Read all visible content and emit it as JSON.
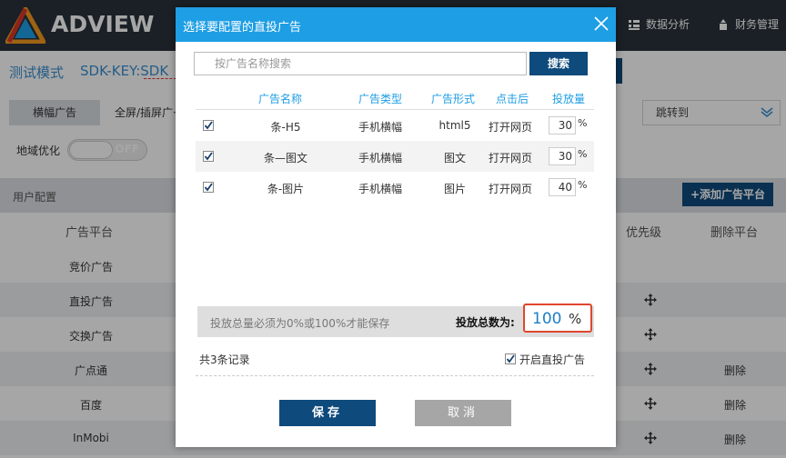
{
  "app": {
    "logo_text": "ADVIEW",
    "nav": [
      {
        "label": "数据分析",
        "icon": "chart-icon"
      },
      {
        "label": "财务管理",
        "icon": "money-icon"
      }
    ]
  },
  "subheader": {
    "mode": "测试模式",
    "sdk_key_label": "SDK-KEY:SDK"
  },
  "tabs": [
    {
      "label": "横幅广告",
      "active": true
    },
    {
      "label": "全屏/插屏广·",
      "active": false
    }
  ],
  "jump_select": {
    "label": "跳转到"
  },
  "geo": {
    "label": "地域优化",
    "toggle_text": "OFF"
  },
  "user_config": {
    "label": "用户配置",
    "add_button": "+添加广告平台"
  },
  "platform_table": {
    "headers": {
      "platform": "广告平台",
      "priority": "优先级",
      "delete": "删除平台"
    },
    "rows": [
      {
        "name": "竞价广告",
        "move": false,
        "delete": ""
      },
      {
        "name": "直投广告",
        "move": true,
        "delete": ""
      },
      {
        "name": "交换广告",
        "move": true,
        "delete": ""
      },
      {
        "name": "广点通",
        "move": true,
        "delete": "删除"
      },
      {
        "name": "百度",
        "move": true,
        "delete": "删除"
      },
      {
        "name": "InMobi",
        "move": true,
        "delete": "删除"
      }
    ]
  },
  "modal": {
    "title": "选择要配置的直投广告",
    "search_placeholder": "按广告名称搜索",
    "search_button": "搜索",
    "headers": {
      "name": "广告名称",
      "type": "广告类型",
      "format": "广告形式",
      "click": "点击后",
      "quantity": "投放量"
    },
    "rows": [
      {
        "checked": true,
        "name": "条-H5",
        "type": "手机横幅",
        "format": "html5",
        "click": "打开网页",
        "quantity": "30",
        "unit": "%"
      },
      {
        "checked": true,
        "name": "条—图文",
        "type": "手机横幅",
        "format": "图文",
        "click": "打开网页",
        "quantity": "30",
        "unit": "%"
      },
      {
        "checked": true,
        "name": "条-图片",
        "type": "手机横幅",
        "format": "图片",
        "click": "打开网页",
        "quantity": "40",
        "unit": "%"
      }
    ],
    "notice": "投放总量必须为0%或100%才能保存",
    "total_label": "投放总数为:",
    "total_value": "100",
    "total_unit": "%",
    "record_count": "共3条记录",
    "enable_label": "开启直投广告",
    "save_button": "保存",
    "cancel_button": "取消"
  },
  "colors": {
    "header_blue": "#1e9ee4",
    "navy": "#0e4a7b",
    "highlight_red": "#e0462f"
  }
}
